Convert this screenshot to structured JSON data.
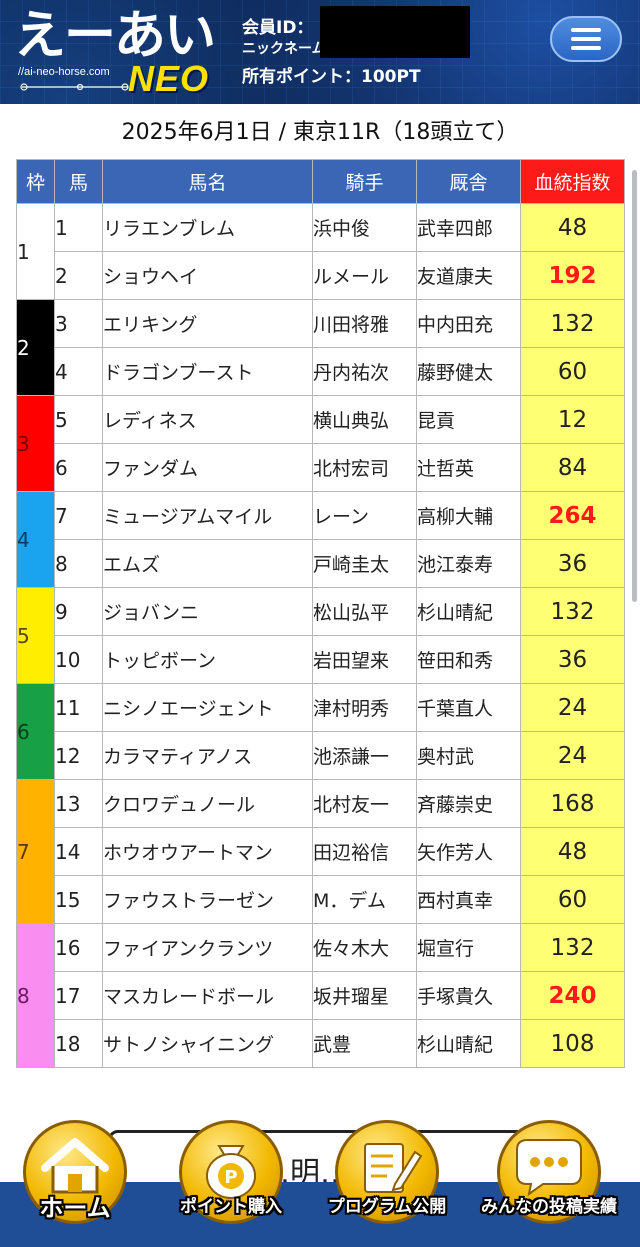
{
  "header": {
    "logo_text": "えーあい",
    "logo_url": "//ai-neo-horse.com",
    "logo_sub": "NEO",
    "member_id_label": "会員ID：",
    "nickname_label": "ニックネーム：",
    "points_label": "所有ポイント：100PT"
  },
  "race": {
    "title": "2025年6月1日 / 東京11R（18頭立て）"
  },
  "table": {
    "headers": [
      "枠",
      "馬",
      "馬名",
      "騎手",
      "厩舎",
      "血統指数"
    ],
    "frames": [
      {
        "label": "1",
        "bg": "#ffffff",
        "fg": "#222222",
        "rows": 2
      },
      {
        "label": "2",
        "bg": "#000000",
        "fg": "#ffffff",
        "rows": 2
      },
      {
        "label": "3",
        "bg": "#ff0000",
        "fg": "#7a0000",
        "rows": 2
      },
      {
        "label": "4",
        "bg": "#1aa3ef",
        "fg": "#0a3a66",
        "rows": 2
      },
      {
        "label": "5",
        "bg": "#ffee00",
        "fg": "#5a4a00",
        "rows": 2
      },
      {
        "label": "6",
        "bg": "#17a045",
        "fg": "#08401c",
        "rows": 2
      },
      {
        "label": "7",
        "bg": "#ffb300",
        "fg": "#5a3a00",
        "rows": 3
      },
      {
        "label": "8",
        "bg": "#f98df0",
        "fg": "#6a1a60",
        "rows": 3
      }
    ],
    "rows": [
      {
        "num": "1",
        "name": "リラエンブレム",
        "jockey": "浜中俊",
        "trainer": "武幸四郎",
        "score": "48",
        "highlight": false
      },
      {
        "num": "2",
        "name": "ショウヘイ",
        "jockey": "ルメール",
        "trainer": "友道康夫",
        "score": "192",
        "highlight": true
      },
      {
        "num": "3",
        "name": "エリキング",
        "jockey": "川田将雅",
        "trainer": "中内田充",
        "score": "132",
        "highlight": false
      },
      {
        "num": "4",
        "name": "ドラゴンブースト",
        "jockey": "丹内祐次",
        "trainer": "藤野健太",
        "score": "60",
        "highlight": false
      },
      {
        "num": "5",
        "name": "レディネス",
        "jockey": "横山典弘",
        "trainer": "昆貢",
        "score": "12",
        "highlight": false
      },
      {
        "num": "6",
        "name": "ファンダム",
        "jockey": "北村宏司",
        "trainer": "辻哲英",
        "score": "84",
        "highlight": false
      },
      {
        "num": "7",
        "name": "ミュージアムマイル",
        "jockey": "レーン",
        "trainer": "高柳大輔",
        "score": "264",
        "highlight": true
      },
      {
        "num": "8",
        "name": "エムズ",
        "jockey": "戸崎圭太",
        "trainer": "池江泰寿",
        "score": "36",
        "highlight": false
      },
      {
        "num": "9",
        "name": "ジョバンニ",
        "jockey": "松山弘平",
        "trainer": "杉山晴紀",
        "score": "132",
        "highlight": false
      },
      {
        "num": "10",
        "name": "トッピボーン",
        "jockey": "岩田望来",
        "trainer": "笹田和秀",
        "score": "36",
        "highlight": false
      },
      {
        "num": "11",
        "name": "ニシノエージェント",
        "jockey": "津村明秀",
        "trainer": "千葉直人",
        "score": "24",
        "highlight": false
      },
      {
        "num": "12",
        "name": "カラマティアノス",
        "jockey": "池添謙一",
        "trainer": "奥村武",
        "score": "24",
        "highlight": false
      },
      {
        "num": "13",
        "name": "クロワデュノール",
        "jockey": "北村友一",
        "trainer": "斉藤崇史",
        "score": "168",
        "highlight": false
      },
      {
        "num": "14",
        "name": "ホウオウアートマン",
        "jockey": "田辺裕信",
        "trainer": "矢作芳人",
        "score": "48",
        "highlight": false
      },
      {
        "num": "15",
        "name": "ファウストラーゼン",
        "jockey": "M．デム",
        "trainer": "西村真幸",
        "score": "60",
        "highlight": false
      },
      {
        "num": "16",
        "name": "ファイアンクランツ",
        "jockey": "佐々木大",
        "trainer": "堀宣行",
        "score": "132",
        "highlight": false
      },
      {
        "num": "17",
        "name": "マスカレードボール",
        "jockey": "坂井瑠星",
        "trainer": "手塚貴久",
        "score": "240",
        "highlight": true
      },
      {
        "num": "18",
        "name": "サトノシャイニング",
        "jockey": "武豊",
        "trainer": "杉山晴紀",
        "score": "108",
        "highlight": false
      }
    ]
  },
  "more_button": {
    "label": "…明…る"
  },
  "nav": [
    {
      "label": "ホーム",
      "icon": "home-icon"
    },
    {
      "label": "ポイント購入",
      "icon": "coin-bag-icon"
    },
    {
      "label": "プログラム公開",
      "icon": "document-edit-icon"
    },
    {
      "label": "みんなの投稿実績",
      "icon": "chat-bubble-icon"
    }
  ],
  "colors": {
    "header_bg": "#0b1f48",
    "table_header": "#3a66b5",
    "index_header": "#ff1a1a",
    "score_bg": "#ffff73",
    "score_highlight": "#ff1a1a",
    "nav_bg": "#1f4e97"
  }
}
